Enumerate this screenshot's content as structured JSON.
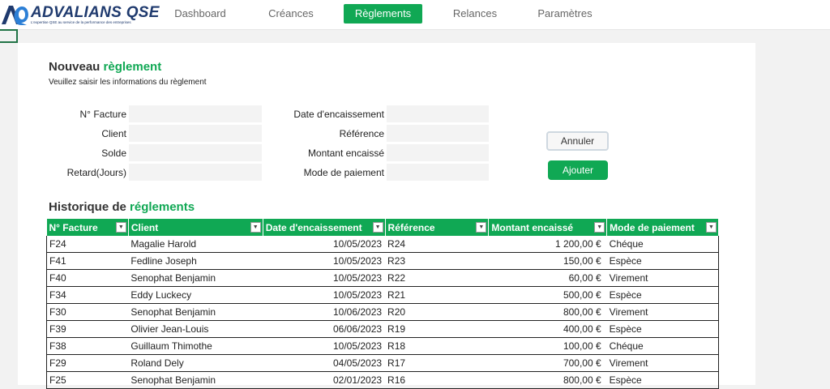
{
  "brand": {
    "name": "ADVALIANS QSE",
    "tagline": "L'expertise QSE au service de la performance des entreprises",
    "color": "#1f3a6e"
  },
  "nav": [
    {
      "label": "Dashboard",
      "active": false
    },
    {
      "label": "Créances",
      "active": false
    },
    {
      "label": "Règlements",
      "active": true
    },
    {
      "label": "Relances",
      "active": false
    },
    {
      "label": "Paramètres",
      "active": false
    }
  ],
  "accent": "#10a854",
  "form": {
    "title_a": "Nouveau ",
    "title_b": "règlement",
    "subtitle": "Veuillez saisir les informations du règlement",
    "left_fields": [
      "N° Facture",
      "Client",
      "Solde",
      "Retard(Jours)"
    ],
    "right_fields": [
      "Date d'encaissement",
      "Référence",
      "Montant encaissé",
      "Mode de paiement"
    ],
    "cancel": "Annuler",
    "add": "Ajouter"
  },
  "history": {
    "title_a": "Historique de ",
    "title_b": "réglements",
    "columns": [
      "N° Facture",
      "Client",
      "Date d'encaissement",
      "Référence",
      "Montant encaissé",
      "Mode de paiement"
    ],
    "rows": [
      [
        "F24",
        "Magalie Harold",
        "10/05/2023",
        "R24",
        "1 200,00 €",
        "Chéque"
      ],
      [
        "F41",
        "Fedline Joseph",
        "10/05/2023",
        "R23",
        "150,00 €",
        "Espèce"
      ],
      [
        "F40",
        "Senophat Benjamin",
        "10/05/2023",
        "R22",
        "60,00 €",
        "Virement"
      ],
      [
        "F34",
        "Eddy Luckecy",
        "10/05/2023",
        "R21",
        "500,00 €",
        "Espèce"
      ],
      [
        "F30",
        "Senophat Benjamin",
        "10/06/2023",
        "R20",
        "800,00 €",
        "Virement"
      ],
      [
        "F39",
        "Olivier Jean-Louis",
        "06/06/2023",
        "R19",
        "400,00 €",
        "Espèce"
      ],
      [
        "F38",
        "Guillaum Thimothe",
        "10/05/2023",
        "R18",
        "100,00 €",
        "Chéque"
      ],
      [
        "F29",
        "Roland Dely",
        "04/05/2023",
        "R17",
        "700,00 €",
        "Virement"
      ],
      [
        "F25",
        "Senophat Benjamin",
        "02/01/2023",
        "R16",
        "800,00 €",
        "Espèce"
      ]
    ]
  }
}
